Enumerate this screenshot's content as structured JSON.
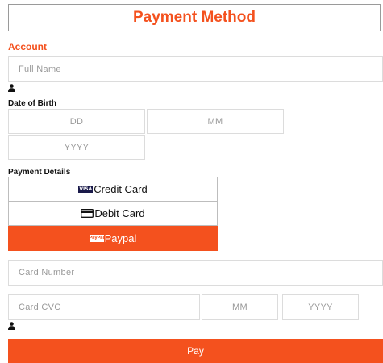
{
  "header": {
    "title": "Payment Method"
  },
  "account": {
    "section_label": "Account",
    "full_name_placeholder": "Full Name",
    "dob_label": "Date of Birth",
    "dd_placeholder": "DD",
    "mm_placeholder": "MM",
    "yyyy_placeholder": "YYYY"
  },
  "payment": {
    "section_label": "Payment Details",
    "options": [
      {
        "label": "Credit Card",
        "icon": "visa-icon",
        "badge": "VISA"
      },
      {
        "label": "Debit Card",
        "icon": "debit-card-icon"
      },
      {
        "label": "Paypal",
        "icon": "paypal-icon",
        "badge": "PayPal",
        "selected": true
      }
    ],
    "card_number_placeholder": "Card Number",
    "card_cvc_placeholder": "Card CVC",
    "exp_mm_placeholder": "MM",
    "exp_yyyy_placeholder": "YYYY"
  },
  "actions": {
    "pay_label": "Pay"
  },
  "colors": {
    "accent": "#f4511e",
    "border": "#dcdcdc"
  }
}
